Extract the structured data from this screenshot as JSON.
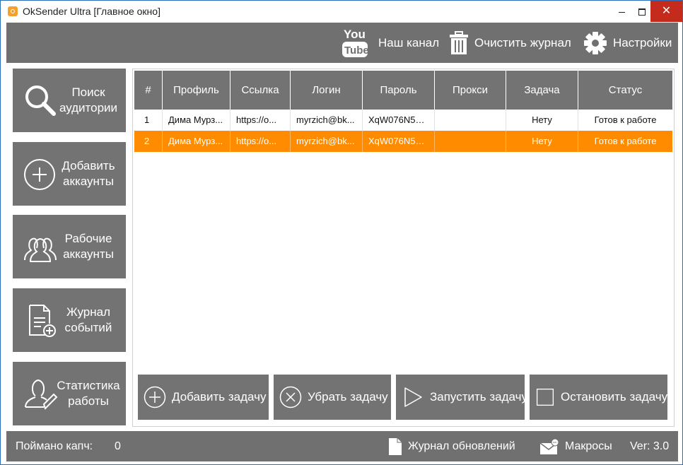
{
  "window": {
    "title": "OkSender Ultra [Главное окно]",
    "minimize_label": "",
    "close_label": "✕"
  },
  "toolbar": {
    "youtube_logo": {
      "top": "You",
      "bottom": "Tube"
    },
    "channel_label": "Наш канал",
    "clear_log_label": "Очистить журнал",
    "settings_label": "Настройки"
  },
  "sidebar": {
    "items": [
      {
        "label": "Поиск\nаудитории",
        "icon": "search-icon"
      },
      {
        "label": "Добавить\nаккаунты",
        "icon": "plus-circle-icon"
      },
      {
        "label": "Рабочие\nаккаунты",
        "icon": "users-icon"
      },
      {
        "label": "Журнал\nсобытий",
        "icon": "document-add-icon"
      },
      {
        "label": "Статистика\nработы",
        "icon": "user-edit-icon"
      }
    ]
  },
  "table": {
    "columns": [
      "#",
      "Профиль",
      "Ссылка",
      "Логин",
      "Пароль",
      "Прокси",
      "Задача",
      "Статус"
    ],
    "rows": [
      {
        "num": "1",
        "profile": "Дима Мурз...",
        "link": "https://o...",
        "login": "myrzich@bk...",
        "password": "XqW076N5G...",
        "proxy": "",
        "task": "Нету",
        "status": "Готов к работе",
        "selected": false
      },
      {
        "num": "2",
        "profile": "Дима Мурз...",
        "link": "https://o...",
        "login": "myrzich@bk...",
        "password": "XqW076N5G...",
        "proxy": "",
        "task": "Нету",
        "status": "Готов к работе",
        "selected": true
      }
    ],
    "selected_color": "#ff8c00"
  },
  "actions": {
    "add_task": "Добавить задачу",
    "remove_task": "Убрать задачу",
    "start_task": "Запустить задачу",
    "stop_task": "Остановить задачу"
  },
  "status": {
    "captcha_label": "Поймано капч:",
    "captcha_count": "0",
    "updates_label": "Журнал обновлений",
    "macros_label": "Макросы",
    "version": "Ver: 3.0"
  },
  "colors": {
    "panel_gray": "#707070",
    "accent_orange": "#ff8c00",
    "close_red": "#c42b1c"
  }
}
